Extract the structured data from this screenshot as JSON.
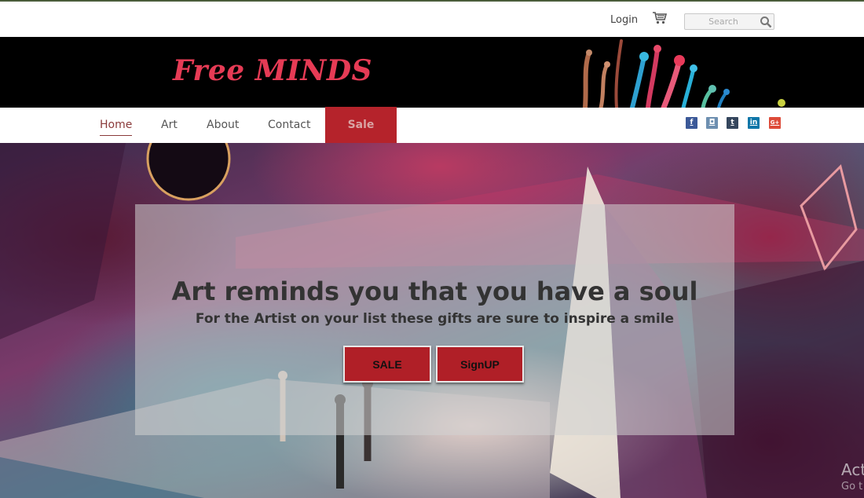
{
  "topbar": {
    "login_label": "Login",
    "cart_icon": "cart-icon",
    "search_placeholder": "Search",
    "search_icon": "magnifier-icon"
  },
  "header": {
    "logo_text": "Free MINDS",
    "logo_color": "#e63b55"
  },
  "nav": {
    "items": [
      {
        "label": "Home",
        "active": true
      },
      {
        "label": "Art"
      },
      {
        "label": "About"
      },
      {
        "label": "Contact"
      },
      {
        "label": "Sale"
      }
    ],
    "social": [
      {
        "name": "facebook-icon",
        "glyph": "f"
      },
      {
        "name": "instagram-icon",
        "glyph": "◘"
      },
      {
        "name": "tumblr-icon",
        "glyph": "t"
      },
      {
        "name": "linkedin-icon",
        "glyph": "in"
      },
      {
        "name": "googleplus-icon",
        "glyph": "G+"
      }
    ],
    "accent_color": "#b5232b"
  },
  "hero": {
    "headline": "Art reminds you that you have a soul",
    "subline": "For the Artist on your list these gifts are sure to inspire a smile",
    "buttons": {
      "sale_label": "SALE",
      "signup_label": "SignUP"
    },
    "button_color": "#b01f27"
  },
  "watermark": {
    "line1": "Act",
    "line2": "Go t"
  }
}
